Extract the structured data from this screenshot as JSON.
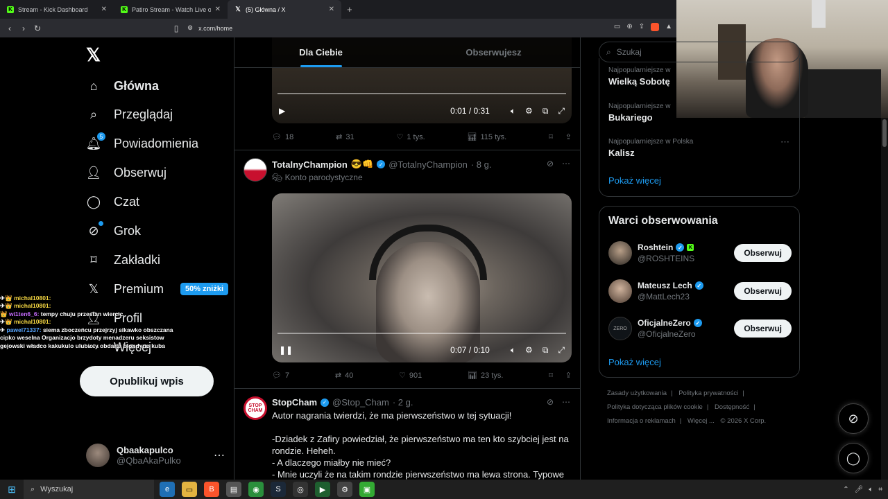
{
  "browser": {
    "tabs": [
      {
        "title": "Stream - Kick Dashboard",
        "favicon": "kick-icon",
        "active": false
      },
      {
        "title": "Patiro Stream - Watch Live on Kick",
        "favicon": "kick-icon",
        "active": false
      },
      {
        "title": "(5) Główna / X",
        "favicon": "x-icon",
        "active": true
      }
    ],
    "url": "x.com/home"
  },
  "sidebar": {
    "nav": [
      {
        "label": "Główna",
        "icon": "home-icon"
      },
      {
        "label": "Przeglądaj",
        "icon": "search-icon"
      },
      {
        "label": "Powiadomienia",
        "icon": "bell-icon",
        "badge": "5"
      },
      {
        "label": "Obserwuj",
        "icon": "follow-icon"
      },
      {
        "label": "Czat",
        "icon": "chat-icon"
      },
      {
        "label": "Grok",
        "icon": "grok-icon"
      },
      {
        "label": "Zakładki",
        "icon": "bookmark-icon"
      },
      {
        "label": "Premium",
        "icon": "x-icon",
        "promo": "50% zniżki"
      },
      {
        "label": "Profil",
        "icon": "person-icon"
      },
      {
        "label": "Więcej",
        "icon": "more-icon"
      }
    ],
    "post_button": "Opublikuj wpis",
    "profile": {
      "name": "Qbaakapulco",
      "handle": "@QbaAkaPulko"
    }
  },
  "chat_overlay": [
    {
      "user": "michal10801:",
      "msg": "",
      "color": "#f5d742"
    },
    {
      "user": "michal10801:",
      "msg": "",
      "color": "#f5d742"
    },
    {
      "user": "wi1ten6_6:",
      "msg": "tempy chuju przestan wiercic",
      "color": "#c76cff"
    },
    {
      "user": "michal10801:",
      "msg": "",
      "color": "#f5d742"
    },
    {
      "user": "pawel71337:",
      "msg": "siema zboczeńcu przejrzyj sikawko obszczana cipko weselna Organizacjo brzydoty menadzeru seksistow gejowski władco kakukulo ulubioty obdarta blondyno kuba",
      "color": "#58a6ff"
    }
  ],
  "feed": {
    "tabs": [
      "Dla Ciebie",
      "Obserwujesz"
    ],
    "post1": {
      "video_time": "0:01 / 0:31",
      "stats": {
        "replies": "18",
        "reposts": "31",
        "likes": "1 tys.",
        "views": "115 tys."
      }
    },
    "post2": {
      "name": "TotalnyChampion",
      "emoji": "😎👊",
      "handle": "@TotalnyChampion",
      "time": "· 8 g.",
      "subtitle": "Konto parodystyczne",
      "video_time": "0:07 / 0:10",
      "stats": {
        "replies": "7",
        "reposts": "40",
        "likes": "901",
        "views": "23 tys."
      }
    },
    "post3": {
      "name": "StopCham",
      "handle": "@Stop_Cham",
      "time": "· 2 g.",
      "text": "Autor nagrania twierdzi, że ma pierwszeństwo w tej sytuacji!\n\n-Dziadek z Zafiry powiedział, że pierwszeństwo ma ten kto szybciej jest na rondzie. Heheh.\n- A dlaczego miałby nie mieć?\n- Mnie uczyli że na takim rondzie pierwszeństwo ma lewa strona. Typowe"
    }
  },
  "right": {
    "search_placeholder": "Szukaj",
    "trends": [
      {
        "context": "Najpopularniejsze w",
        "topic": "Wielką Sobotę"
      },
      {
        "context": "Najpopularniejsze w",
        "topic": "Bukariego"
      },
      {
        "context": "Najpopularniejsze w Polska",
        "topic": "Kalisz"
      }
    ],
    "show_more": "Pokaż więcej",
    "follow_title": "Warci obserwowania",
    "follow": [
      {
        "name": "Roshtein",
        "handle": "@ROSHTEINS",
        "button": "Obserwuj"
      },
      {
        "name": "Mateusz Lech",
        "handle": "@MattLech23",
        "button": "Obserwuj"
      },
      {
        "name": "OficjalneZero",
        "handle": "@OficjalneZero",
        "button": "Obserwuj"
      }
    ],
    "follow_more": "Pokaż więcej",
    "footer": [
      "Zasady użytkowania",
      "|",
      "Polityka prywatności",
      "|",
      "Polityka dotycząca plików cookie",
      "|",
      "Dostępność",
      "|",
      "Informacja o reklamach",
      "|",
      "Więcej ...",
      "© 2026 X Corp."
    ]
  },
  "taskbar": {
    "search": "Wyszukaj"
  }
}
